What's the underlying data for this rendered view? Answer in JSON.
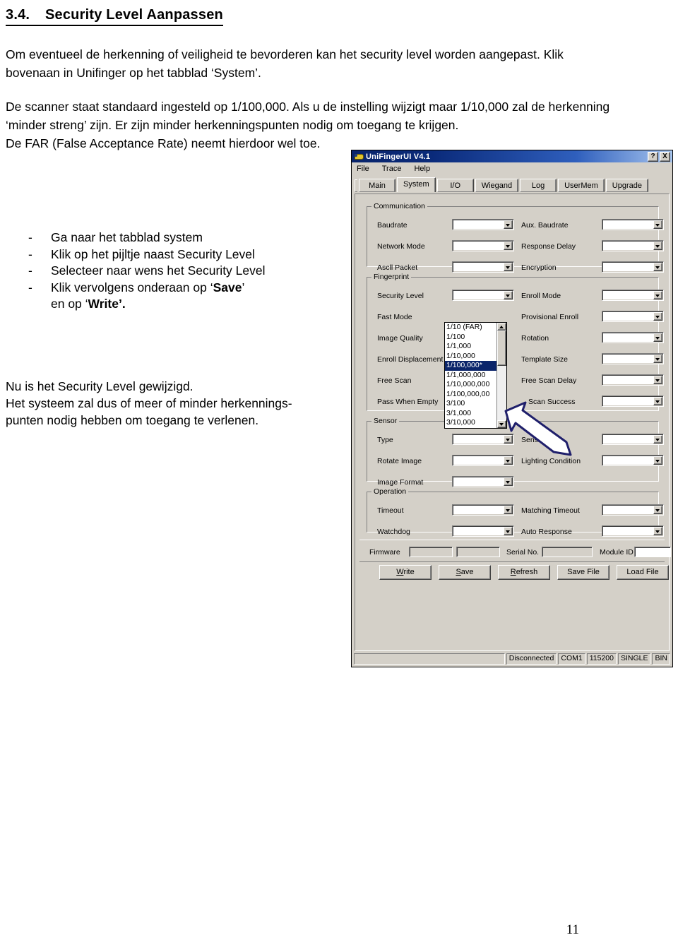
{
  "document": {
    "heading_number": "3.4.",
    "heading_title": "Security Level Aanpassen",
    "paragraph_intro": "Om eventueel de herkenning of veiligheid te bevorderen kan het security level worden aangepast. Klik bovenaan in Unifinger op het tabblad ‘System’.",
    "paragraph_scanner": "De scanner staat standaard ingesteld op 1/100,000. Als u de instelling wijzigt maar 1/10,000 zal de herkenning ‘minder streng’ zijn. Er zijn minder herkenningspunten nodig om toegang te krijgen.\nDe FAR (False Acceptance Rate) neemt hierdoor wel toe.",
    "steps": [
      "Ga naar het tabblad system",
      "Klik op het pijltje naast Security Level",
      "Selecteer naar wens het Security Level"
    ],
    "step_last_pre": "Klik vervolgens onderaan op ‘",
    "step_last_bold": "Save",
    "step_last_mid": "’",
    "step_last_line2_pre": "en op ‘",
    "step_last_line2_bold": "Write",
    "step_last_line2_post": "’.",
    "paragraph_closing": "Nu is het Security Level gewijzigd.\nHet systeem zal dus of meer of minder herkennings-\npunten nodig hebben om toegang te verlenen.",
    "page_number": "11"
  },
  "app": {
    "title": "UniFingerUI V4.1",
    "titlebar_help_label": "?",
    "titlebar_close_label": "X",
    "menu": [
      "File",
      "Trace",
      "Help"
    ],
    "tabs": [
      {
        "label": "Main",
        "active": false
      },
      {
        "label": "System",
        "active": true
      },
      {
        "label": "I/O",
        "active": false
      },
      {
        "label": "Wiegand",
        "active": false
      },
      {
        "label": "Log",
        "active": false
      },
      {
        "label": "UserMem",
        "active": false
      },
      {
        "label": "Upgrade",
        "active": false
      }
    ],
    "groups": {
      "communication": {
        "legend": "Communication",
        "left": [
          "Baudrate",
          "Network Mode",
          "Ascll Packet"
        ],
        "right": [
          "Aux. Baudrate",
          "Response Delay",
          "Encryption"
        ]
      },
      "fingerprint": {
        "legend": "Fingerprint",
        "left": [
          "Security Level",
          "Fast Mode",
          "Image Quality",
          "Enroll Displacement",
          "Free Scan",
          "Pass When Empty"
        ],
        "right": [
          "Enroll Mode",
          "Provisional Enroll",
          "Rotation",
          "Template Size",
          "Free Scan Delay",
          "Scan Success"
        ]
      },
      "sensor": {
        "legend": "Sensor",
        "left": [
          "Type",
          "Rotate Image",
          "Image Format"
        ],
        "right": [
          "Sensitivity",
          "Lighting Condition"
        ]
      },
      "operation": {
        "legend": "Operation",
        "left": [
          "Timeout",
          "Watchdog"
        ],
        "right": [
          "Matching Timeout",
          "Auto Response"
        ]
      }
    },
    "info": {
      "firmware_label": "Firmware",
      "firmware_value_1": "",
      "firmware_value_2": "",
      "serial_label": "Serial No.",
      "serial_value": "",
      "module_label": "Module ID",
      "module_value": ""
    },
    "security_dropdown": {
      "open": true,
      "selected_index": 4,
      "options": [
        "1/10 (FAR)",
        "1/100",
        "1/1,000",
        "1/10,000",
        "1/100,000*",
        "1/1,000,000",
        "1/10,000,000",
        "1/100,000,00",
        "3/100",
        "3/1,000",
        "3/10,000"
      ]
    },
    "buttons": [
      {
        "label": "Write",
        "accel": "W"
      },
      {
        "label": "Save",
        "accel": "S"
      },
      {
        "label": "Refresh",
        "accel": "R"
      },
      {
        "label": "Save File",
        "accel": ""
      },
      {
        "label": "Load File",
        "accel": ""
      }
    ],
    "statusbar": {
      "message": "",
      "connection": "Disconnected",
      "port": "COM1",
      "baud": "115200",
      "mode": "SINGLE",
      "format": "BIN"
    },
    "colors": {
      "face": "#d4d0c8",
      "title_start": "#08246b",
      "title_end": "#a8c6ef",
      "selection": "#0a246a",
      "callout_outline": "#1f1f6b"
    }
  }
}
